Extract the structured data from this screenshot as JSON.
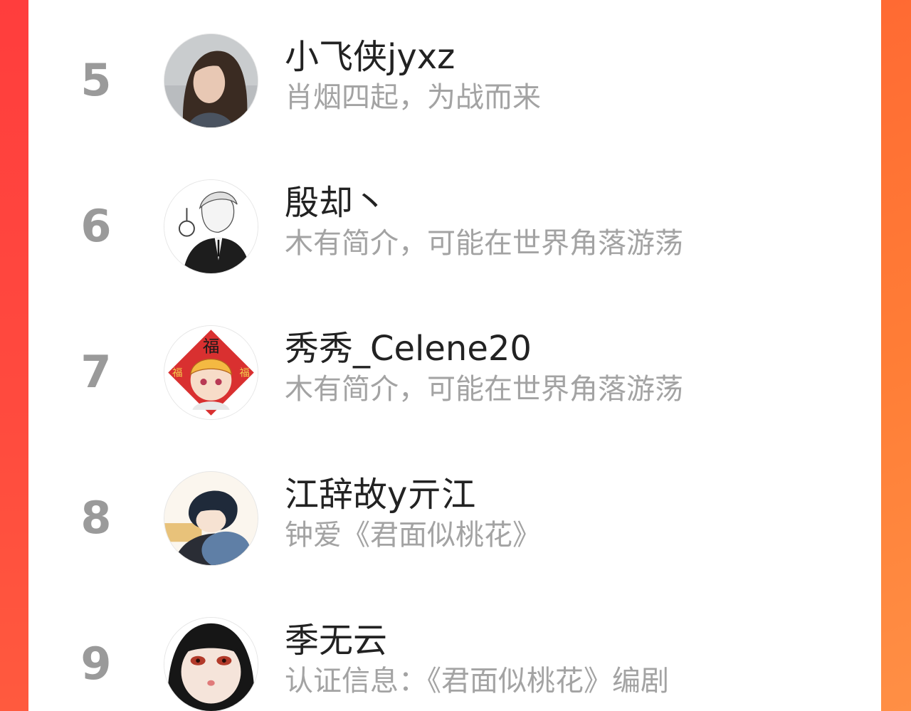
{
  "ranking": {
    "items": [
      {
        "rank": "5",
        "name": "小飞侠jyxz",
        "bio": "肖烟四起，为战而来",
        "avatar": "woman-photo-avatar"
      },
      {
        "rank": "6",
        "name": "殷却丶",
        "bio": "木有简介，可能在世界角落游荡",
        "avatar": "sketch-man-lantern-avatar"
      },
      {
        "rank": "7",
        "name": "秀秀_Celene20",
        "bio": "木有简介，可能在世界角落游荡",
        "avatar": "fu-tiger-girl-avatar"
      },
      {
        "rank": "8",
        "name": "江辞故y亓江",
        "bio": "钟爱《君面似桃花》",
        "avatar": "sleeping-boy-avatar"
      },
      {
        "rank": "9",
        "name": "季无云",
        "bio": "认证信息：《君面似桃花》编剧",
        "avatar": "red-eyed-girl-avatar"
      }
    ],
    "fu_char": "福"
  },
  "colors": {
    "accent_left": "#ff4a3c",
    "accent_right": "#ff7d36",
    "rank_gray": "#9a9a9a",
    "name_text": "#222222",
    "bio_text": "#a3a3a3"
  }
}
